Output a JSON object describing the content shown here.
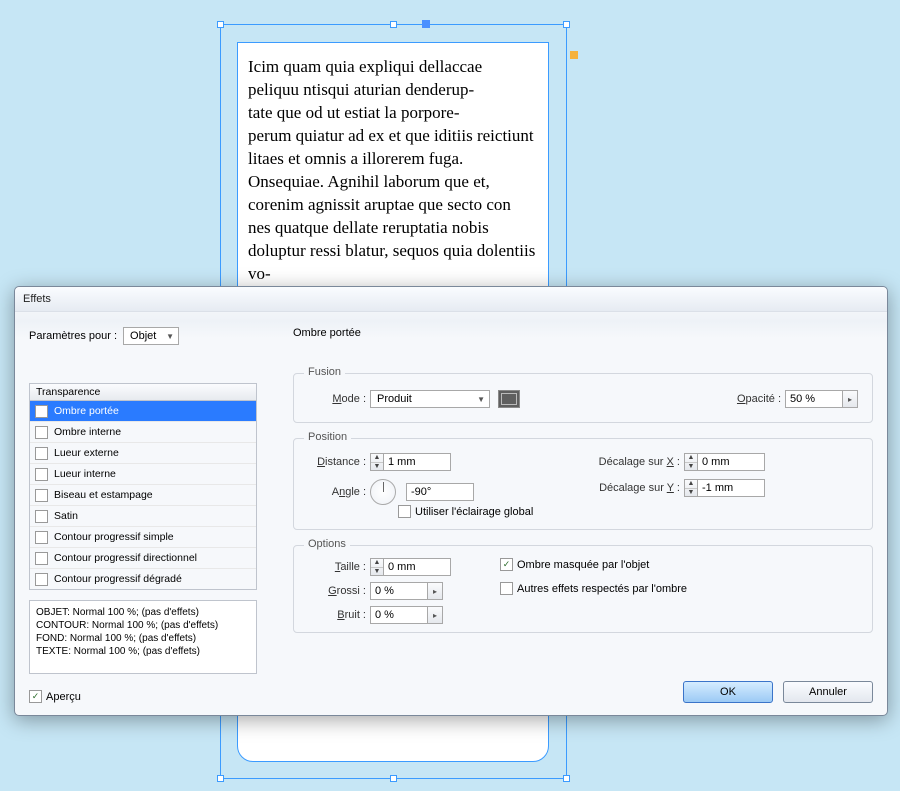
{
  "document": {
    "text": "Icim quam quia expliqui dellaccae peliquu ntisqui aturian denderup-\ntate que od ut estiat la porpore-\nperum quiatur ad ex et que iditiis reictiunt litaes et omnis a illorerem fuga. Onsequiae. Agnihil laborum que et, corenim agnissit aruptae que secto con nes quatque dellate reruptatia nobis doluptur ressi blatur, sequos quia dolentiis vo-\nluptatque volorisci nessum adis porum, torum assita volupitat vo-\nloremus vel ium net aut reribus.\nNiat eos volore, consequis poreru nt, to tenimin verro voluptat ullati conse nihiliquam, corum, expe volorei ctiorerspit inum et eos exere voluptati tem quia peraero ratur? Apitaquam, nimus dolorer empersp ictium ad quiassequae berem. Aspe experna tquatur? Rumquaes aut imus, quae velendae quia corit autecus etum quos mil"
  },
  "dialog": {
    "title": "Effets",
    "params_label": "Paramètres pour :",
    "target": "Objet",
    "section_title": "Ombre portée",
    "list_header": "Transparence",
    "effects": [
      {
        "label": "Ombre portée",
        "selected": true
      },
      {
        "label": "Ombre interne"
      },
      {
        "label": "Lueur externe"
      },
      {
        "label": "Lueur interne"
      },
      {
        "label": "Biseau et estampage"
      },
      {
        "label": "Satin"
      },
      {
        "label": "Contour progressif simple"
      },
      {
        "label": "Contour progressif directionnel"
      },
      {
        "label": "Contour progressif dégradé"
      }
    ],
    "summary": [
      "OBJET: Normal 100 %; (pas d'effets)",
      "CONTOUR: Normal 100 %; (pas d'effets)",
      "FOND: Normal 100 %; (pas d'effets)",
      "TEXTE: Normal 100 %; (pas d'effets)"
    ],
    "preview_label": "Aperçu",
    "groups": {
      "fusion_legend": "Fusion",
      "position_legend": "Position",
      "options_legend": "Options"
    },
    "fields": {
      "mode_label": "Mode :",
      "mode_value": "Produit",
      "opacity_label_pre": "O",
      "opacity_label": "pacité :",
      "opacity_value": "50 %",
      "distance_label_u": "D",
      "distance_label": "istance :",
      "distance_value": "1 mm",
      "angle_label_pre": "A",
      "angle_label_u": "n",
      "angle_label_post": "gle :",
      "angle_value": "-90°",
      "global_light_label": "Utiliser l'éclairage global",
      "offx_label_pre": "Décalage sur ",
      "offx_label_u": "X",
      "offx_label_post": " :",
      "offx_value": "0 mm",
      "offy_label_pre": "Décalage sur ",
      "offy_label_u": "Y",
      "offy_label_post": " :",
      "offy_value": "-1 mm",
      "size_label_u": "T",
      "size_label": "aille :",
      "size_value": "0 mm",
      "spread_label_u": "G",
      "spread_label": "rossi :",
      "spread_value": "0 %",
      "noise_label_u": "B",
      "noise_label": "ruit :",
      "noise_value": "0 %",
      "knockout_label": "Ombre masquée par l'objet",
      "honors_label": "Autres effets respectés par l'ombre"
    },
    "buttons": {
      "ok": "OK",
      "cancel": "Annuler"
    }
  }
}
